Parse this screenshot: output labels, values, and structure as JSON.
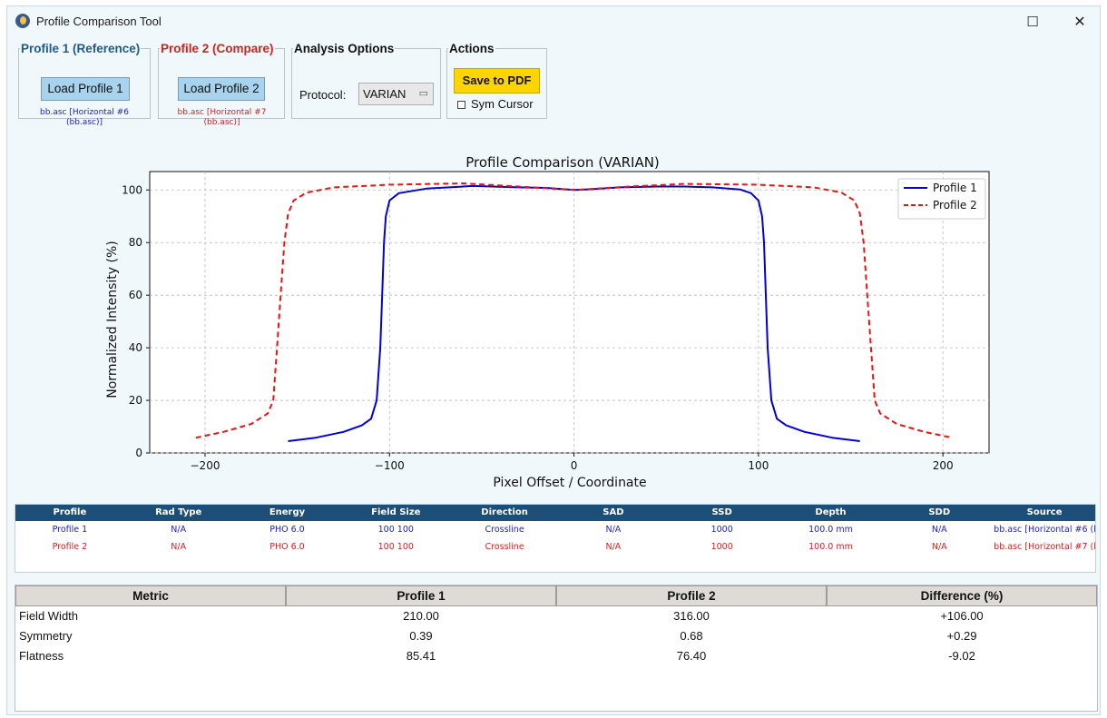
{
  "window": {
    "title": "Profile Comparison Tool",
    "maximize_glyph": "☐",
    "close_glyph": "✕"
  },
  "groups": {
    "profile1": {
      "legend": "Profile 1 (Reference)",
      "button": "Load Profile 1",
      "file": "bb.asc [Horizontal #6 (bb.asc)]",
      "color": "#1f5a8a",
      "file_color": "#2020cc"
    },
    "profile2": {
      "legend": "Profile 2 (Compare)",
      "button": "Load Profile 2",
      "file": "bb.asc [Horizontal #7 (bb.asc)]",
      "color": "#d62020",
      "file_color": "#d62020"
    },
    "analysis": {
      "legend": "Analysis Options",
      "protocol_label": "Protocol:",
      "protocol_value": "VARIAN",
      "dropdown_icon": "dropdown-arrow-icon"
    },
    "actions": {
      "legend": "Actions",
      "save_pdf": "Save to PDF",
      "sym_cursor_label": "Sym Cursor",
      "sym_cursor_checked": false,
      "save_color": "#ffd500"
    }
  },
  "chart_data": {
    "type": "line",
    "title": "Profile Comparison (VARIAN)",
    "xlabel": "Pixel Offset / Coordinate",
    "ylabel": "Normalized Intensity (%)",
    "xlim": [
      -230,
      225
    ],
    "ylim": [
      0,
      107
    ],
    "xticks": [
      -200,
      -100,
      0,
      100,
      200
    ],
    "yticks": [
      0,
      20,
      40,
      60,
      80,
      100
    ],
    "xtick_labels": [
      "−200",
      "−100",
      "0",
      "100",
      "200"
    ],
    "ytick_labels": [
      "0",
      "20",
      "40",
      "60",
      "80",
      "100"
    ],
    "grid": true,
    "legend_position": "top-right",
    "series": [
      {
        "name": "Profile 1",
        "color": "#0000dd",
        "style": "solid",
        "points": [
          [
            -155,
            4.5
          ],
          [
            -140,
            5.8
          ],
          [
            -125,
            8
          ],
          [
            -115,
            10.5
          ],
          [
            -110,
            13
          ],
          [
            -107,
            20
          ],
          [
            -105,
            40
          ],
          [
            -104,
            60
          ],
          [
            -103,
            80
          ],
          [
            -102,
            90
          ],
          [
            -100,
            96
          ],
          [
            -95,
            98.8
          ],
          [
            -80,
            100.5
          ],
          [
            -55,
            101.5
          ],
          [
            -30,
            101
          ],
          [
            -15,
            100.8
          ],
          [
            0,
            100
          ],
          [
            10,
            100.3
          ],
          [
            25,
            101
          ],
          [
            45,
            101.3
          ],
          [
            60,
            101.3
          ],
          [
            75,
            101
          ],
          [
            90,
            100.2
          ],
          [
            96,
            98.8
          ],
          [
            100,
            96
          ],
          [
            102,
            90
          ],
          [
            103,
            80
          ],
          [
            104,
            60
          ],
          [
            105,
            40
          ],
          [
            107,
            20
          ],
          [
            110,
            13
          ],
          [
            115,
            10.5
          ],
          [
            125,
            8
          ],
          [
            140,
            5.8
          ],
          [
            155,
            4.5
          ]
        ]
      },
      {
        "name": "Profile 2",
        "color": "#ee1111",
        "style": "dashed",
        "points": [
          [
            -205,
            5.8
          ],
          [
            -190,
            8
          ],
          [
            -175,
            11
          ],
          [
            -166,
            15
          ],
          [
            -163,
            20
          ],
          [
            -161,
            40
          ],
          [
            -159,
            60
          ],
          [
            -157,
            80
          ],
          [
            -155,
            91
          ],
          [
            -152,
            96
          ],
          [
            -145,
            99
          ],
          [
            -130,
            101
          ],
          [
            -100,
            102
          ],
          [
            -60,
            102.5
          ],
          [
            -30,
            101.3
          ],
          [
            0,
            100
          ],
          [
            30,
            101.3
          ],
          [
            60,
            102.3
          ],
          [
            100,
            102
          ],
          [
            130,
            101
          ],
          [
            145,
            99
          ],
          [
            152,
            96
          ],
          [
            155,
            91
          ],
          [
            157,
            80
          ],
          [
            159,
            60
          ],
          [
            161,
            40
          ],
          [
            163,
            20
          ],
          [
            166,
            15
          ],
          [
            175,
            11
          ],
          [
            190,
            8
          ],
          [
            205,
            5.8
          ]
        ]
      }
    ]
  },
  "info_table": {
    "headers": [
      "Profile",
      "Rad Type",
      "Energy",
      "Field Size",
      "Direction",
      "SAD",
      "SSD",
      "Depth",
      "SDD",
      "Source"
    ],
    "rows": [
      [
        "Profile 1",
        "N/A",
        "PHO 6.0",
        "100 100",
        "Crossline",
        "N/A",
        "1000",
        "100.0 mm",
        "N/A",
        "bb.asc [Horizontal #6 (b"
      ],
      [
        "Profile 2",
        "N/A",
        "PHO 6.0",
        "100 100",
        "Crossline",
        "N/A",
        "1000",
        "100.0 mm",
        "N/A",
        "bb.asc [Horizontal #7 (b"
      ]
    ],
    "row_colors": [
      "#2020cc",
      "#d62020"
    ]
  },
  "metrics_table": {
    "headers": [
      "Metric",
      "Profile 1",
      "Profile 2",
      "Difference (%)"
    ],
    "rows": [
      [
        "Field Width",
        "210.00",
        "316.00",
        "+106.00"
      ],
      [
        "Symmetry",
        "0.39",
        "0.68",
        "+0.29"
      ],
      [
        "Flatness",
        "85.41",
        "76.40",
        "-9.02"
      ]
    ]
  }
}
